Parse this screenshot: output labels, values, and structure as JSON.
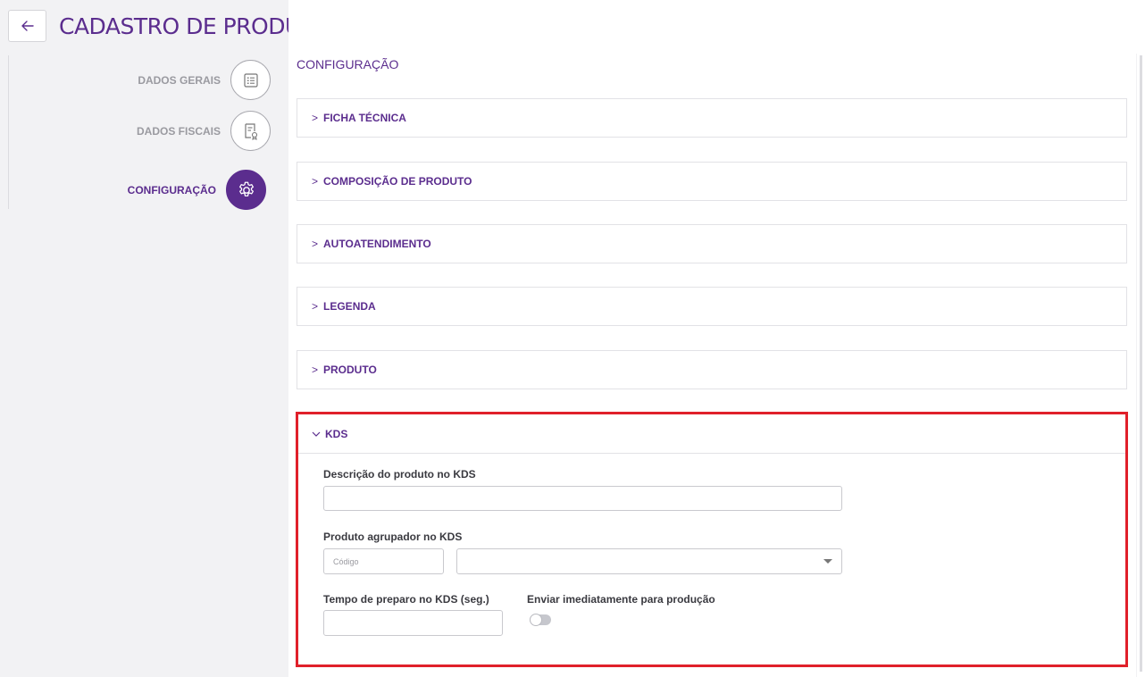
{
  "header": {
    "title": "CADASTRO DE PRODUTO",
    "back_icon": "arrow-left-icon"
  },
  "sidebar": {
    "items": [
      {
        "label": "DADOS GERAIS",
        "icon": "list-icon",
        "active": false
      },
      {
        "label": "DADOS FISCAIS",
        "icon": "document-certificate-icon",
        "active": false
      },
      {
        "label": "CONFIGURAÇÃO",
        "icon": "gear-icon",
        "active": true
      }
    ]
  },
  "main": {
    "section_title": "CONFIGURAÇÃO",
    "panels": [
      {
        "label": "FICHA TÉCNICA",
        "expanded": false
      },
      {
        "label": "COMPOSIÇÃO DE PRODUTO",
        "expanded": false
      },
      {
        "label": "AUTOATENDIMENTO",
        "expanded": false
      },
      {
        "label": "LEGENDA",
        "expanded": false
      },
      {
        "label": "PRODUTO",
        "expanded": false
      }
    ],
    "kds": {
      "label": "KDS",
      "expanded": true,
      "descricao_label": "Descrição do produto no KDS",
      "descricao_value": "",
      "agrupador_label": "Produto agrupador no KDS",
      "codigo_placeholder": "Código",
      "agrupador_value": "",
      "tempo_label": "Tempo de preparo no KDS (seg.)",
      "tempo_value": "",
      "enviar_label": "Enviar imediatamente para produção",
      "enviar_on": false
    }
  },
  "colors": {
    "brand": "#5b2d8e",
    "highlight": "#e0202a"
  }
}
